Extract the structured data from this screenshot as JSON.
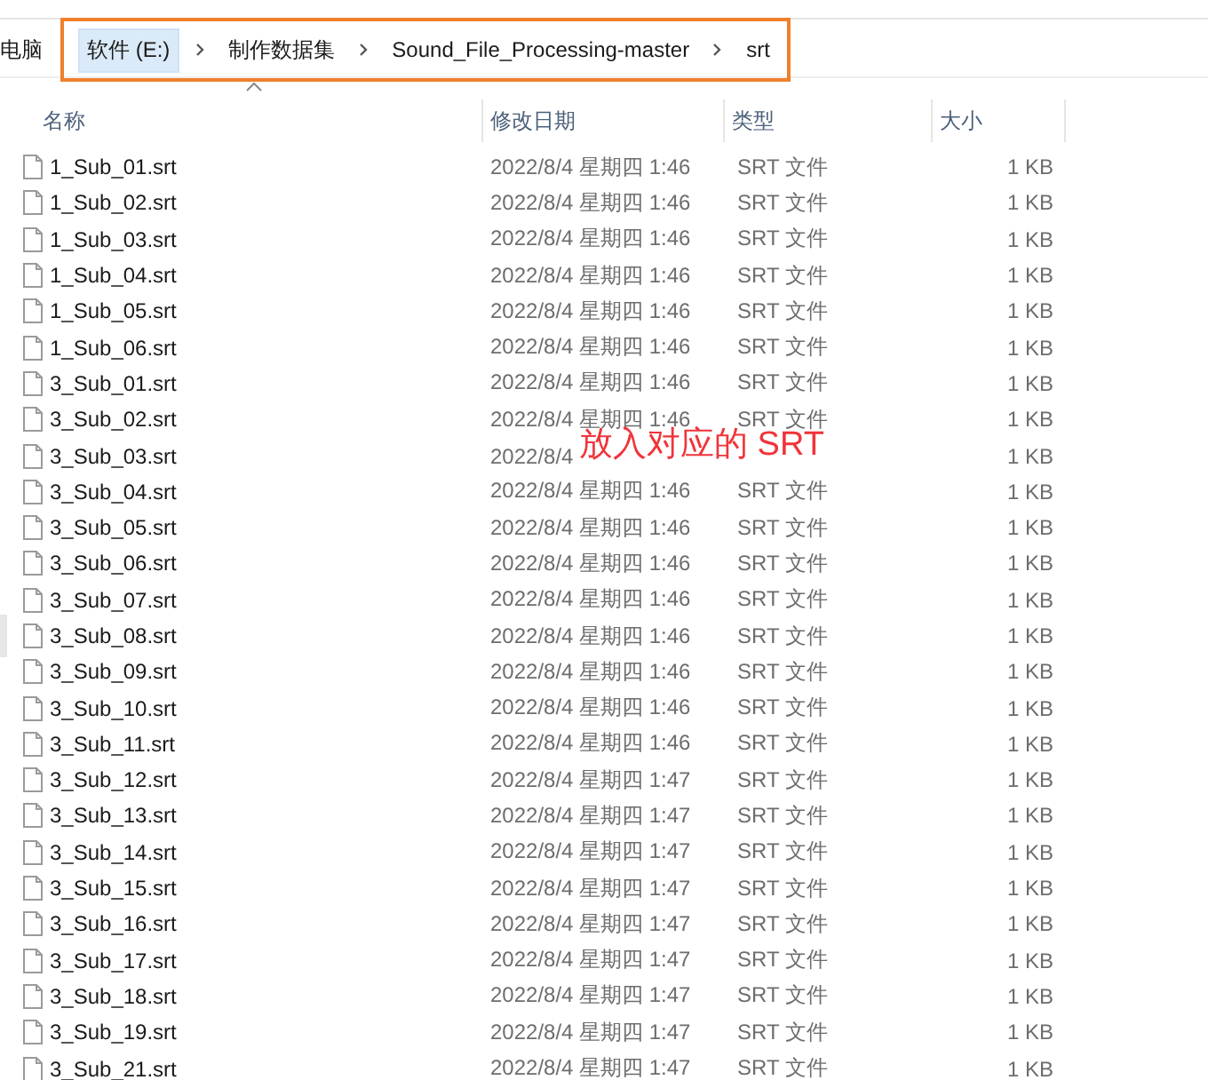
{
  "address_bar": {
    "cut_item": "电脑",
    "items": [
      {
        "label": "软件 (E:)",
        "selected": true
      },
      {
        "label": "制作数据集",
        "selected": false
      },
      {
        "label": "Sound_File_Processing-master",
        "selected": false
      },
      {
        "label": "srt",
        "selected": false
      }
    ]
  },
  "columns": [
    "名称",
    "修改日期",
    "类型",
    "大小"
  ],
  "files": [
    {
      "name": "1_Sub_01.srt",
      "modified": "2022/8/4 星期四 1:46",
      "type": "SRT 文件",
      "size": "1 KB"
    },
    {
      "name": "1_Sub_02.srt",
      "modified": "2022/8/4 星期四 1:46",
      "type": "SRT 文件",
      "size": "1 KB"
    },
    {
      "name": "1_Sub_03.srt",
      "modified": "2022/8/4 星期四 1:46",
      "type": "SRT 文件",
      "size": "1 KB"
    },
    {
      "name": "1_Sub_04.srt",
      "modified": "2022/8/4 星期四 1:46",
      "type": "SRT 文件",
      "size": "1 KB"
    },
    {
      "name": "1_Sub_05.srt",
      "modified": "2022/8/4 星期四 1:46",
      "type": "SRT 文件",
      "size": "1 KB"
    },
    {
      "name": "1_Sub_06.srt",
      "modified": "2022/8/4 星期四 1:46",
      "type": "SRT 文件",
      "size": "1 KB"
    },
    {
      "name": "3_Sub_01.srt",
      "modified": "2022/8/4 星期四 1:46",
      "type": "SRT 文件",
      "size": "1 KB"
    },
    {
      "name": "3_Sub_02.srt",
      "modified": "2022/8/4 星期四 1:46",
      "type": "SRT 文件",
      "size": "1 KB"
    },
    {
      "name": "3_Sub_03.srt",
      "modified": "2022/8/4",
      "size": "1 KB"
    },
    {
      "name": "3_Sub_04.srt",
      "modified": "2022/8/4 星期四 1:46",
      "type": "SRT 文件",
      "size": "1 KB"
    },
    {
      "name": "3_Sub_05.srt",
      "modified": "2022/8/4 星期四 1:46",
      "type": "SRT 文件",
      "size": "1 KB"
    },
    {
      "name": "3_Sub_06.srt",
      "modified": "2022/8/4 星期四 1:46",
      "type": "SRT 文件",
      "size": "1 KB"
    },
    {
      "name": "3_Sub_07.srt",
      "modified": "2022/8/4 星期四 1:46",
      "type": "SRT 文件",
      "size": "1 KB"
    },
    {
      "name": "3_Sub_08.srt",
      "modified": "2022/8/4 星期四 1:46",
      "type": "SRT 文件",
      "size": "1 KB"
    },
    {
      "name": "3_Sub_09.srt",
      "modified": "2022/8/4 星期四 1:46",
      "type": "SRT 文件",
      "size": "1 KB"
    },
    {
      "name": "3_Sub_10.srt",
      "modified": "2022/8/4 星期四 1:46",
      "type": "SRT 文件",
      "size": "1 KB"
    },
    {
      "name": "3_Sub_11.srt",
      "modified": "2022/8/4 星期四 1:46",
      "type": "SRT 文件",
      "size": "1 KB"
    },
    {
      "name": "3_Sub_12.srt",
      "modified": "2022/8/4 星期四 1:47",
      "type": "SRT 文件",
      "size": "1 KB"
    },
    {
      "name": "3_Sub_13.srt",
      "modified": "2022/8/4 星期四 1:47",
      "type": "SRT 文件",
      "size": "1 KB"
    },
    {
      "name": "3_Sub_14.srt",
      "modified": "2022/8/4 星期四 1:47",
      "type": "SRT 文件",
      "size": "1 KB"
    },
    {
      "name": "3_Sub_15.srt",
      "modified": "2022/8/4 星期四 1:47",
      "type": "SRT 文件",
      "size": "1 KB"
    },
    {
      "name": "3_Sub_16.srt",
      "modified": "2022/8/4 星期四 1:47",
      "type": "SRT 文件",
      "size": "1 KB"
    },
    {
      "name": "3_Sub_17.srt",
      "modified": "2022/8/4 星期四 1:47",
      "type": "SRT 文件",
      "size": "1 KB"
    },
    {
      "name": "3_Sub_18.srt",
      "modified": "2022/8/4 星期四 1:47",
      "type": "SRT 文件",
      "size": "1 KB"
    },
    {
      "name": "3_Sub_19.srt",
      "modified": "2022/8/4 星期四 1:47",
      "type": "SRT 文件",
      "size": "1 KB"
    },
    {
      "name": "3_Sub_21.srt",
      "modified": "2022/8/4 星期四 1:47",
      "type": "SRT 文件",
      "size": "1 KB"
    }
  ],
  "annotation": "放入对应的 SRT"
}
